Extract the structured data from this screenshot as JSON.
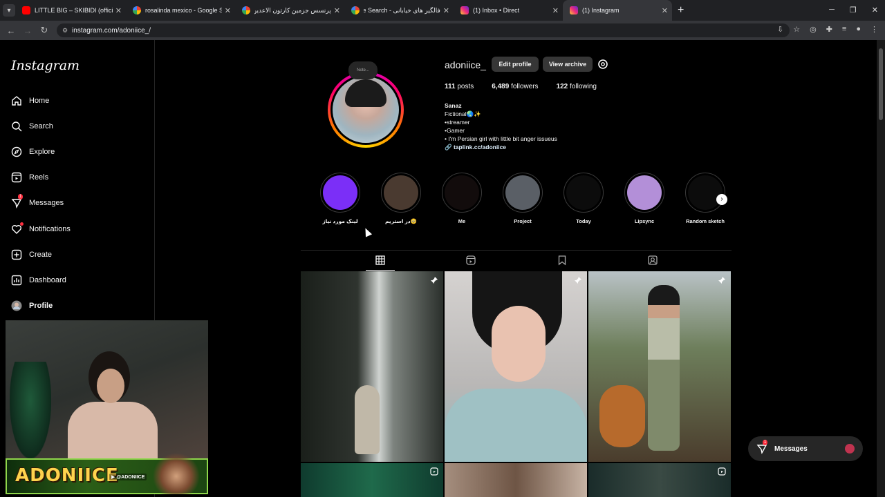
{
  "browser": {
    "tabs": [
      {
        "title": "LITTLE BIG – SKIBIDI (official mu",
        "icon": "youtube-icon",
        "active": false
      },
      {
        "title": "rosalinda mexico - Google Searc",
        "icon": "google-icon",
        "active": false
      },
      {
        "title": "پرنسس جزمین کارتون الاعدین - Search",
        "icon": "google-icon",
        "active": false
      },
      {
        "title": "فالگیر های خیابانی - Google Search",
        "icon": "google-icon",
        "active": false
      },
      {
        "title": "(1) Inbox • Direct",
        "icon": "instagram-icon",
        "active": false
      },
      {
        "title": "(1) Instagram",
        "icon": "instagram-icon",
        "active": true
      }
    ],
    "url": "instagram.com/adoniice_/"
  },
  "sidebar": {
    "logo": "Instagram",
    "items": [
      {
        "label": "Home",
        "icon": "home-icon"
      },
      {
        "label": "Search",
        "icon": "search-icon"
      },
      {
        "label": "Explore",
        "icon": "compass-icon"
      },
      {
        "label": "Reels",
        "icon": "reels-icon"
      },
      {
        "label": "Messages",
        "icon": "messenger-icon",
        "badge": "1"
      },
      {
        "label": "Notifications",
        "icon": "heart-icon"
      },
      {
        "label": "Create",
        "icon": "plus-square-icon"
      },
      {
        "label": "Dashboard",
        "icon": "chart-icon"
      },
      {
        "label": "Profile",
        "icon": "avatar-icon"
      }
    ]
  },
  "webcam": {
    "banner_title": "ADONIICE",
    "banner_handle": "@ADONIICE"
  },
  "profile": {
    "note": "Note...",
    "username": "adoniice_",
    "edit_label": "Edit profile",
    "archive_label": "View archive",
    "posts_count": "111",
    "posts_label": "posts",
    "followers_count": "6,489",
    "followers_label": "followers",
    "following_count": "122",
    "following_label": "following",
    "bio_name": "Sanaz",
    "bio_lines": [
      "Fictional🌏✨",
      "•streamer",
      "•Gamer",
      "• I'm Persian girl with little bit anger issueus"
    ],
    "bio_link": "taplink.cc/adoniice"
  },
  "highlights": [
    {
      "label": "لینک مورد نیاز",
      "color": "#7b2ff7"
    },
    {
      "label": "در استریم🥺",
      "color": "#4a3a30"
    },
    {
      "label": "Me",
      "color": "#120c0c"
    },
    {
      "label": "Project",
      "color": "#5a5f66"
    },
    {
      "label": "Today",
      "color": "#0c0c0c"
    },
    {
      "label": "Lipsync",
      "color": "#b38fd8"
    },
    {
      "label": "Random sketch",
      "color": "#0c0c0c"
    }
  ],
  "profile_tabs": [
    "posts-grid-icon",
    "reels-icon",
    "saved-icon",
    "tagged-icon"
  ],
  "messages_float": {
    "label": "Messages",
    "badge": "1"
  }
}
